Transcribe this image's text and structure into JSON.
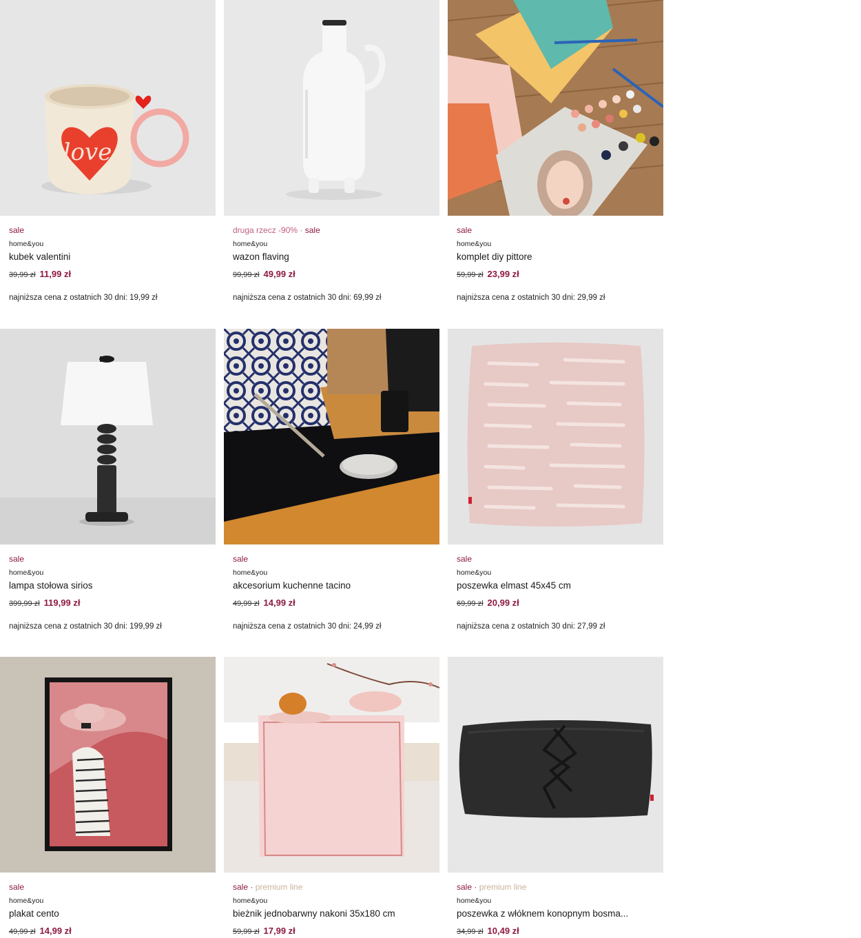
{
  "products": [
    {
      "badges": [
        "sale"
      ],
      "brand": "home&you",
      "name": "kubek valentini",
      "old_price": "39,99 zł",
      "new_price": "11,99 zł",
      "lowest": "najniższa cena z ostatnich 30 dni: 19,99 zł"
    },
    {
      "badges": [
        "druga rzecz -90%",
        "sale"
      ],
      "brand": "home&you",
      "name": "wazon flaving",
      "old_price": "99,99 zł",
      "new_price": "49,99 zł",
      "lowest": "najniższa cena z ostatnich 30 dni: 69,99 zł"
    },
    {
      "badges": [
        "sale"
      ],
      "brand": "home&you",
      "name": "komplet diy pittore",
      "old_price": "59,99 zł",
      "new_price": "23,99 zł",
      "lowest": "najniższa cena z ostatnich 30 dni: 29,99 zł"
    },
    {
      "badges": [
        "sale"
      ],
      "brand": "home&you",
      "name": "lampa stołowa sirios",
      "old_price": "399,99 zł",
      "new_price": "119,99 zł",
      "lowest": "najniższa cena z ostatnich 30 dni: 199,99 zł"
    },
    {
      "badges": [
        "sale"
      ],
      "brand": "home&you",
      "name": "akcesorium kuchenne tacino",
      "old_price": "49,99 zł",
      "new_price": "14,99 zł",
      "lowest": "najniższa cena z ostatnich 30 dni: 24,99 zł"
    },
    {
      "badges": [
        "sale"
      ],
      "brand": "home&you",
      "name": "poszewka elmast 45x45 cm",
      "old_price": "69,99 zł",
      "new_price": "20,99 zł",
      "lowest": "najniższa cena z ostatnich 30 dni: 27,99 zł"
    },
    {
      "badges": [
        "sale"
      ],
      "brand": "home&you",
      "name": "plakat cento",
      "old_price": "49,99 zł",
      "new_price": "14,99 zł",
      "lowest": ""
    },
    {
      "badges": [
        "sale",
        "premium line"
      ],
      "brand": "home&you",
      "name": "bieżnik jednobarwny nakoni 35x180 cm",
      "old_price": "59,99 zł",
      "new_price": "17,99 zł",
      "lowest": ""
    },
    {
      "badges": [
        "sale",
        "premium line"
      ],
      "brand": "home&you",
      "name": "poszewka z włóknem konopnym bosma...",
      "old_price": "34,99 zł",
      "new_price": "10,49 zł",
      "lowest": ""
    }
  ],
  "badge_separator": "·",
  "colors": {
    "sale": "#8e1a3f",
    "promo": "#c1607e",
    "premium": "#c9b39a"
  }
}
